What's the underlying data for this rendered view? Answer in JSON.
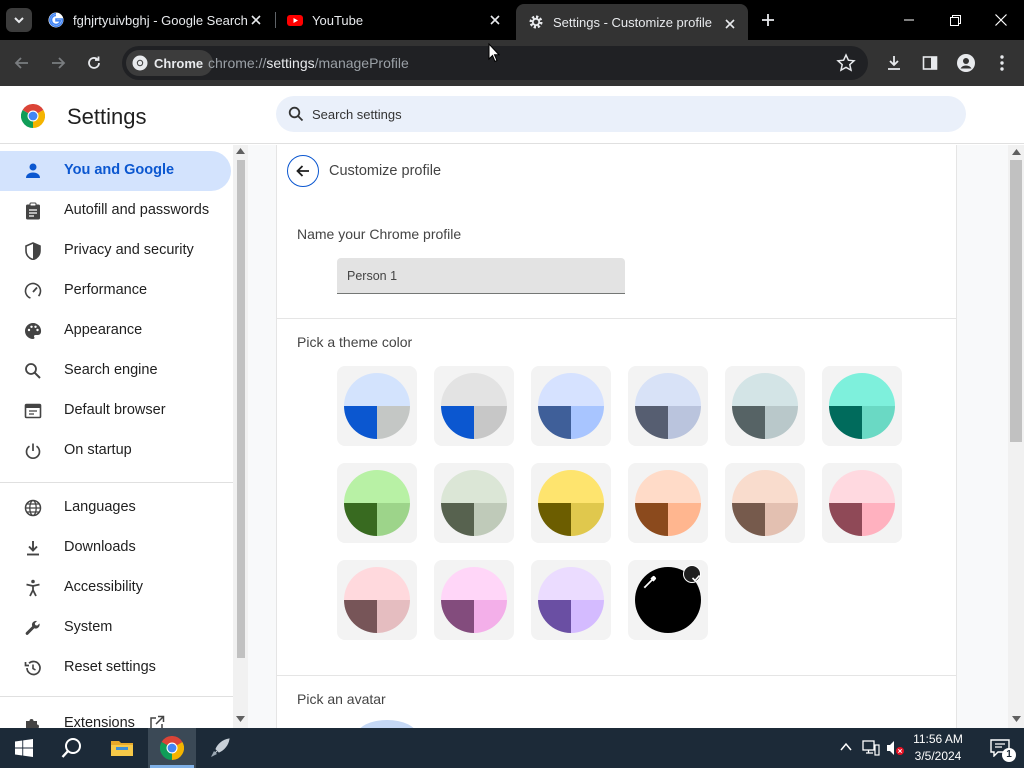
{
  "tabs": [
    {
      "title": "fghjrtyuivbghj - Google Search",
      "icon": "google-icon"
    },
    {
      "title": "YouTube",
      "icon": "youtube-icon"
    },
    {
      "title": "Settings - Customize profile",
      "icon": "gear-icon",
      "active": true
    }
  ],
  "omnibox": {
    "chip_label": "Chrome",
    "url_scheme": "chrome://",
    "url_host": "settings",
    "url_path": "/manageProfile"
  },
  "settings": {
    "title": "Settings",
    "search_placeholder": "Search settings"
  },
  "sidebar": {
    "items": [
      {
        "label": "You and Google",
        "icon": "person-icon",
        "selected": true
      },
      {
        "label": "Autofill and passwords",
        "icon": "clipboard-icon"
      },
      {
        "label": "Privacy and security",
        "icon": "shield-icon"
      },
      {
        "label": "Performance",
        "icon": "speedometer-icon"
      },
      {
        "label": "Appearance",
        "icon": "palette-icon"
      },
      {
        "label": "Search engine",
        "icon": "search-icon"
      },
      {
        "label": "Default browser",
        "icon": "browser-icon"
      },
      {
        "label": "On startup",
        "icon": "power-icon"
      },
      {
        "label": "Languages",
        "icon": "globe-icon"
      },
      {
        "label": "Downloads",
        "icon": "download-icon"
      },
      {
        "label": "Accessibility",
        "icon": "accessibility-icon"
      },
      {
        "label": "System",
        "icon": "wrench-icon"
      },
      {
        "label": "Reset settings",
        "icon": "history-icon"
      },
      {
        "label": "Extensions",
        "icon": "puzzle-icon"
      }
    ]
  },
  "page": {
    "title": "Customize profile",
    "name_label": "Name your Chrome profile",
    "name_value": "Person 1",
    "theme_label": "Pick a theme color",
    "avatar_label": "Pick an avatar"
  },
  "theme_colors": [
    {
      "top": "#d3e3fd",
      "left": "#0b57d0",
      "right": "#c4c7c5"
    },
    {
      "top": "#e3e3e3",
      "left": "#0b57d0",
      "right": "#c7c7c7"
    },
    {
      "top": "#d6e2ff",
      "left": "#3f5f99",
      "right": "#a8c5ff"
    },
    {
      "top": "#d8e2f7",
      "left": "#565e71",
      "right": "#bac4dd"
    },
    {
      "top": "#d3e4e6",
      "left": "#566365",
      "right": "#b9c8ca"
    },
    {
      "top": "#7ef0dc",
      "left": "#006b5c",
      "right": "#6ad9c4"
    },
    {
      "top": "#b8f1a5",
      "left": "#386a20",
      "right": "#9dd48a"
    },
    {
      "top": "#dbe6d6",
      "left": "#57624f",
      "right": "#bfcab9"
    },
    {
      "top": "#fee46e",
      "left": "#6c5d00",
      "right": "#e0c84d"
    },
    {
      "top": "#ffdbc8",
      "left": "#8b4a1d",
      "right": "#ffb68f"
    },
    {
      "top": "#f9dccd",
      "left": "#765a4c",
      "right": "#e3c0b1"
    },
    {
      "top": "#ffd9e0",
      "left": "#8f4957",
      "right": "#ffb1bf"
    },
    {
      "top": "#ffd9dd",
      "left": "#775558",
      "right": "#e5bdc0"
    },
    {
      "top": "#ffd6f8",
      "left": "#834c7d",
      "right": "#f3afe9"
    },
    {
      "top": "#ebdcff",
      "left": "#6a4fa3",
      "right": "#d4bbff"
    }
  ],
  "custom_color": {
    "fill": "#000000",
    "selected": true
  },
  "taskbar": {
    "time": "11:56 AM",
    "date": "3/5/2024",
    "notification_count": "1"
  }
}
